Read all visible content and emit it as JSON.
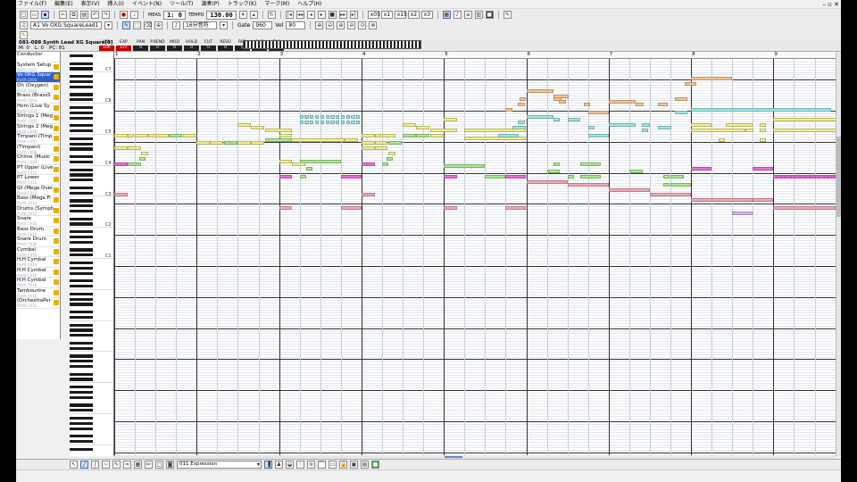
{
  "menu": [
    "ファイル(F)",
    "編集(E)",
    "表示(V)",
    "挿入(I)",
    "イベント(N)",
    "ツール(T)",
    "演奏(P)",
    "トラック(K)",
    "マーク(M)",
    "ヘルプ(H)"
  ],
  "toolbar": {
    "meas_label": "MEAS",
    "position": "1:  0",
    "tempo_label": "TEMPO",
    "tempo": "130.00",
    "tb_buttons": [
      "x05",
      "x1",
      "x15",
      "x2",
      "x3"
    ]
  },
  "toolbar2": {
    "track_select": "A1 Vo OXG SquareLead1",
    "quantize": "16分音符",
    "gate_label": "Gate",
    "gate": "960",
    "vel_label": "Vel",
    "vel": "80"
  },
  "trackinfo": {
    "name": "081-088 Synth Lead XG Square[0]",
    "meta": [
      {
        "k": "M",
        "v": "0"
      },
      {
        "k": "L",
        "v": "0"
      },
      {
        "k": "PC",
        "v": "81"
      }
    ],
    "params": [
      {
        "k": "VOL",
        "v": "100",
        "hl": true
      },
      {
        "k": "EXP",
        "v": "127",
        "hl": true
      },
      {
        "k": "PAN",
        "v": "0"
      },
      {
        "k": "P.BEND",
        "v": "0"
      },
      {
        "k": "MOD",
        "v": "0"
      },
      {
        "k": "HOLD",
        "v": "0"
      },
      {
        "k": "CUT",
        "v": "0"
      },
      {
        "k": "RESO",
        "v": "0"
      },
      {
        "k": "REV",
        "v": "0"
      },
      {
        "k": "CHO",
        "v": "0"
      },
      {
        "k": "DLY",
        "v": "0"
      }
    ]
  },
  "tracks": [
    {
      "name": "Conductor",
      "sub": "",
      "sel": false,
      "spk": false
    },
    {
      "name": "System Setup",
      "sub": "PartA Ch01",
      "sel": false,
      "spk": true
    },
    {
      "name": "Vo OXG Squar",
      "sub": "PartA Ch01",
      "sel": true,
      "spk": true
    },
    {
      "name": "Oh (Oxygen)",
      "sub": "PartA Ch02",
      "sel": false,
      "spk": true
    },
    {
      "name": "Brass (BrassS",
      "sub": "PartA Ch03",
      "sel": false,
      "spk": true
    },
    {
      "name": "Horn (Live Sy",
      "sub": "PartA Ch04",
      "sel": false,
      "spk": true
    },
    {
      "name": "Strings 1 (Meg",
      "sub": "PartA Ch05",
      "sel": false,
      "spk": true
    },
    {
      "name": "Strings 2 (Meg",
      "sub": "PartA Ch06",
      "sel": false,
      "spk": true
    },
    {
      "name": "Timpani (Timp",
      "sub": "PartA Ch07",
      "sel": false,
      "spk": true
    },
    {
      "name": "(Timpani)",
      "sub": "PartA Ch08",
      "sel": false,
      "spk": true
    },
    {
      "name": "Chime (Music",
      "sub": "PartA Ch09",
      "sel": false,
      "spk": true
    },
    {
      "name": "PT Upper (Live",
      "sub": "PartA Ch11",
      "sel": false,
      "spk": true
    },
    {
      "name": "PT Lower",
      "sub": "PartA Ch12",
      "sel": false,
      "spk": true
    },
    {
      "name": "Gt (Mega Over",
      "sub": "PartA Ch13",
      "sel": false,
      "spk": true
    },
    {
      "name": "Bass (Mega Fi",
      "sub": "PartA Ch14",
      "sel": false,
      "spk": true
    },
    {
      "name": "Drums (Symph",
      "sub": "PartA Ch15",
      "sel": false,
      "spk": true
    },
    {
      "name": "Snare",
      "sub": "PartA Ch16",
      "sel": false,
      "spk": true
    },
    {
      "name": "Bass Drum",
      "sub": "PartA Ch16",
      "sel": false,
      "spk": true
    },
    {
      "name": "Snare Drum",
      "sub": "PartA Ch16",
      "sel": false,
      "spk": true
    },
    {
      "name": "Cymbal",
      "sub": "PartA Ch16",
      "sel": false,
      "spk": true
    },
    {
      "name": "H.H Cymbal",
      "sub": "PartA Ch16",
      "sel": false,
      "spk": true
    },
    {
      "name": "H.H Cymbal",
      "sub": "PartA Ch16",
      "sel": false,
      "spk": true
    },
    {
      "name": "H.H Cymbal",
      "sub": "PartA Ch16",
      "sel": false,
      "spk": true
    },
    {
      "name": "Tambourine",
      "sub": "PartA Ch16",
      "sel": false,
      "spk": true
    },
    {
      "name": "(OrchestraPer",
      "sub": "PartA Ch16",
      "sel": false,
      "spk": true
    }
  ],
  "measures": [
    "1",
    "2",
    "3",
    "4",
    "5",
    "6",
    "7",
    "8",
    "9"
  ],
  "octave_labels": [
    "C7",
    "C6",
    "C5",
    "C4",
    "C3",
    "C2",
    "C1"
  ],
  "bottom": {
    "event_select": "011 Expression"
  },
  "colors": {
    "orange": "#f5c48f",
    "cyan": "#9ee8e4",
    "yellow": "#f4f08a",
    "green": "#a8ea8c",
    "magenta": "#f06ad8",
    "pink": "#f4a7b4",
    "lavender": "#d9b8f0"
  },
  "notes": [
    {
      "m": 8.0,
      "l": 0.5,
      "p": 96,
      "c": "orange"
    },
    {
      "m": 7.92,
      "l": 0.14,
      "p": 94,
      "c": "orange"
    },
    {
      "m": 6.0,
      "l": 0.33,
      "p": 91,
      "c": "orange"
    },
    {
      "m": 6.33,
      "l": 0.18,
      "p": 89,
      "c": "orange"
    },
    {
      "m": 5.92,
      "l": 0.08,
      "p": 88,
      "c": "orange"
    },
    {
      "m": 6.33,
      "l": 0.1,
      "p": 88,
      "c": "orange"
    },
    {
      "m": 6.4,
      "l": 0.08,
      "p": 87,
      "c": "orange"
    },
    {
      "m": 7.0,
      "l": 0.33,
      "p": 87,
      "c": "orange"
    },
    {
      "m": 5.9,
      "l": 0.08,
      "p": 86,
      "c": "orange"
    },
    {
      "m": 6.7,
      "l": 0.08,
      "p": 86,
      "c": "orange"
    },
    {
      "m": 7.33,
      "l": 0.1,
      "p": 86,
      "c": "orange"
    },
    {
      "m": 7.6,
      "l": 0.12,
      "p": 86,
      "c": "orange"
    },
    {
      "m": 7.8,
      "l": 0.16,
      "p": 88,
      "c": "orange"
    },
    {
      "m": 5.75,
      "l": 0.08,
      "p": 84,
      "c": "orange"
    },
    {
      "m": 6.75,
      "l": 0.25,
      "p": 83,
      "c": "orange"
    },
    {
      "m": 8.0,
      "l": 1.7,
      "p": 84,
      "c": "cyan"
    },
    {
      "m": 7.8,
      "l": 0.16,
      "p": 83,
      "c": "cyan"
    },
    {
      "m": 6.0,
      "l": 0.33,
      "p": 81,
      "c": "cyan"
    },
    {
      "m": 6.33,
      "l": 0.08,
      "p": 80,
      "c": "cyan"
    },
    {
      "m": 6.5,
      "l": 0.16,
      "p": 80,
      "c": "cyan"
    },
    {
      "m": 5.9,
      "l": 0.08,
      "p": 79,
      "c": "cyan"
    },
    {
      "m": 7.0,
      "l": 0.33,
      "p": 78,
      "c": "cyan"
    },
    {
      "m": 7.4,
      "l": 0.1,
      "p": 78,
      "c": "cyan"
    },
    {
      "m": 5.83,
      "l": 0.16,
      "p": 77,
      "c": "cyan"
    },
    {
      "m": 6.75,
      "l": 0.08,
      "p": 77,
      "c": "cyan"
    },
    {
      "m": 7.6,
      "l": 0.16,
      "p": 77,
      "c": "cyan"
    },
    {
      "m": 7.4,
      "l": 0.08,
      "p": 76,
      "c": "cyan"
    },
    {
      "m": 6.75,
      "l": 0.25,
      "p": 74,
      "c": "cyan"
    },
    {
      "m": 8.0,
      "l": 0.25,
      "p": 78,
      "c": "yellow"
    },
    {
      "m": 8.42,
      "l": 0.33,
      "p": 78,
      "c": "yellow"
    },
    {
      "m": 8.83,
      "l": 0.08,
      "p": 78,
      "c": "yellow"
    },
    {
      "m": 9.0,
      "l": 0.8,
      "p": 80,
      "c": "yellow"
    },
    {
      "m": 8.0,
      "l": 0.66,
      "p": 76,
      "c": "yellow"
    },
    {
      "m": 8.66,
      "l": 0.1,
      "p": 76,
      "c": "yellow"
    },
    {
      "m": 8.83,
      "l": 0.08,
      "p": 76,
      "c": "yellow"
    },
    {
      "m": 9.0,
      "l": 0.8,
      "p": 76,
      "c": "yellow"
    },
    {
      "m": 8.33,
      "l": 0.08,
      "p": 72,
      "c": "yellow"
    },
    {
      "m": 8.83,
      "l": 0.08,
      "p": 72,
      "c": "yellow"
    },
    {
      "m": 2.5,
      "l": 0.16,
      "p": 78,
      "c": "yellow"
    },
    {
      "m": 2.66,
      "l": 0.16,
      "p": 77,
      "c": "yellow"
    },
    {
      "m": 2.83,
      "l": 0.33,
      "p": 76,
      "c": "yellow"
    },
    {
      "m": 4.5,
      "l": 0.16,
      "p": 78,
      "c": "yellow"
    },
    {
      "m": 4.66,
      "l": 0.16,
      "p": 77,
      "c": "yellow"
    },
    {
      "m": 4.83,
      "l": 0.33,
      "p": 76,
      "c": "yellow"
    },
    {
      "m": 5.0,
      "l": 0.16,
      "p": 80,
      "c": "yellow"
    },
    {
      "m": 5.25,
      "l": 0.75,
      "p": 76,
      "c": "yellow"
    },
    {
      "m": 1.0,
      "l": 0.16,
      "p": 74,
      "c": "yellow"
    },
    {
      "m": 1.16,
      "l": 0.08,
      "p": 74,
      "c": "yellow"
    },
    {
      "m": 1.25,
      "l": 0.16,
      "p": 74,
      "c": "yellow"
    },
    {
      "m": 1.41,
      "l": 0.08,
      "p": 74,
      "c": "yellow"
    },
    {
      "m": 1.5,
      "l": 0.16,
      "p": 74,
      "c": "yellow"
    },
    {
      "m": 1.66,
      "l": 0.16,
      "p": 74,
      "c": "green"
    },
    {
      "m": 1.83,
      "l": 0.16,
      "p": 74,
      "c": "yellow"
    },
    {
      "m": 3.0,
      "l": 0.16,
      "p": 74,
      "c": "yellow"
    },
    {
      "m": 3.0,
      "l": 0.8,
      "p": 72,
      "c": "yellow"
    },
    {
      "m": 3.8,
      "l": 0.16,
      "p": 72,
      "c": "yellow"
    },
    {
      "m": 4.0,
      "l": 0.16,
      "p": 74,
      "c": "yellow"
    },
    {
      "m": 4.16,
      "l": 0.08,
      "p": 74,
      "c": "yellow"
    },
    {
      "m": 4.25,
      "l": 0.16,
      "p": 74,
      "c": "yellow"
    },
    {
      "m": 4.5,
      "l": 0.16,
      "p": 74,
      "c": "green"
    },
    {
      "m": 4.66,
      "l": 0.16,
      "p": 74,
      "c": "green"
    },
    {
      "m": 4.83,
      "l": 0.16,
      "p": 74,
      "c": "yellow"
    },
    {
      "m": 5.25,
      "l": 0.75,
      "p": 73,
      "c": "yellow"
    },
    {
      "m": 2.0,
      "l": 0.16,
      "p": 71,
      "c": "yellow"
    },
    {
      "m": 2.16,
      "l": 0.16,
      "p": 71,
      "c": "yellow"
    },
    {
      "m": 2.33,
      "l": 0.16,
      "p": 71,
      "c": "green"
    },
    {
      "m": 2.5,
      "l": 0.16,
      "p": 71,
      "c": "yellow"
    },
    {
      "m": 2.66,
      "l": 0.16,
      "p": 71,
      "c": "yellow"
    },
    {
      "m": 2.83,
      "l": 0.33,
      "p": 72,
      "c": "green"
    },
    {
      "m": 4.0,
      "l": 0.16,
      "p": 71,
      "c": "yellow"
    },
    {
      "m": 4.16,
      "l": 0.16,
      "p": 71,
      "c": "yellow"
    },
    {
      "m": 4.33,
      "l": 0.16,
      "p": 71,
      "c": "green"
    },
    {
      "m": 5.66,
      "l": 0.25,
      "p": 74,
      "c": "cyan"
    },
    {
      "m": 6.75,
      "l": 0.25,
      "p": 74,
      "c": "cyan"
    },
    {
      "m": 1.0,
      "l": 0.16,
      "p": 69,
      "c": "yellow"
    },
    {
      "m": 1.16,
      "l": 0.16,
      "p": 69,
      "c": "yellow"
    },
    {
      "m": 1.33,
      "l": 0.08,
      "p": 67,
      "c": "yellow"
    },
    {
      "m": 1.3,
      "l": 0.08,
      "p": 65,
      "c": "green"
    },
    {
      "m": 1.0,
      "l": 0.16,
      "p": 63,
      "c": "magenta"
    },
    {
      "m": 1.16,
      "l": 0.16,
      "p": 63,
      "c": "green"
    },
    {
      "m": 4.0,
      "l": 0.16,
      "p": 69,
      "c": "yellow"
    },
    {
      "m": 4.16,
      "l": 0.16,
      "p": 69,
      "c": "yellow"
    },
    {
      "m": 4.33,
      "l": 0.08,
      "p": 67,
      "c": "yellow"
    },
    {
      "m": 4.3,
      "l": 0.08,
      "p": 65,
      "c": "green"
    },
    {
      "m": 3.0,
      "l": 0.16,
      "p": 64,
      "c": "yellow"
    },
    {
      "m": 3.25,
      "l": 0.5,
      "p": 64,
      "c": "green"
    },
    {
      "m": 3.16,
      "l": 0.16,
      "p": 63,
      "c": "yellow"
    },
    {
      "m": 4.0,
      "l": 0.16,
      "p": 63,
      "c": "magenta"
    },
    {
      "m": 4.25,
      "l": 0.08,
      "p": 63,
      "c": "green"
    },
    {
      "m": 5.0,
      "l": 0.5,
      "p": 62,
      "c": "green"
    },
    {
      "m": 6.66,
      "l": 0.25,
      "p": 63,
      "c": "green"
    },
    {
      "m": 6.33,
      "l": 0.08,
      "p": 63,
      "c": "green"
    },
    {
      "m": 3.33,
      "l": 0.08,
      "p": 61,
      "c": "green"
    },
    {
      "m": 6.25,
      "l": 0.16,
      "p": 60,
      "c": "green"
    },
    {
      "m": 7.25,
      "l": 0.16,
      "p": 60,
      "c": "green"
    },
    {
      "m": 8.0,
      "l": 0.25,
      "p": 61,
      "c": "magenta"
    },
    {
      "m": 8.75,
      "l": 0.25,
      "p": 61,
      "c": "magenta"
    },
    {
      "m": 3.0,
      "l": 0.16,
      "p": 58,
      "c": "magenta"
    },
    {
      "m": 3.25,
      "l": 0.08,
      "p": 58,
      "c": "green"
    },
    {
      "m": 3.75,
      "l": 0.25,
      "p": 58,
      "c": "magenta"
    },
    {
      "m": 5.0,
      "l": 0.16,
      "p": 58,
      "c": "magenta"
    },
    {
      "m": 5.5,
      "l": 0.25,
      "p": 58,
      "c": "green"
    },
    {
      "m": 5.75,
      "l": 0.25,
      "p": 58,
      "c": "magenta"
    },
    {
      "m": 6.5,
      "l": 0.08,
      "p": 58,
      "c": "green"
    },
    {
      "m": 6.66,
      "l": 0.25,
      "p": 58,
      "c": "green"
    },
    {
      "m": 7.66,
      "l": 0.08,
      "p": 58,
      "c": "green"
    },
    {
      "m": 7.75,
      "l": 0.16,
      "p": 58,
      "c": "green"
    },
    {
      "m": 9.0,
      "l": 0.75,
      "p": 58,
      "c": "magenta"
    },
    {
      "m": 6.0,
      "l": 0.5,
      "p": 56,
      "c": "pink"
    },
    {
      "m": 6.5,
      "l": 0.5,
      "p": 55,
      "c": "pink"
    },
    {
      "m": 7.66,
      "l": 0.08,
      "p": 55,
      "c": "green"
    },
    {
      "m": 7.75,
      "l": 0.25,
      "p": 55,
      "c": "green"
    },
    {
      "m": 7.0,
      "l": 0.5,
      "p": 53,
      "c": "pink"
    },
    {
      "m": 7.5,
      "l": 0.5,
      "p": 51,
      "c": "pink"
    },
    {
      "m": 1.0,
      "l": 0.16,
      "p": 51,
      "c": "pink"
    },
    {
      "m": 4.0,
      "l": 0.16,
      "p": 51,
      "c": "pink"
    },
    {
      "m": 8.0,
      "l": 0.75,
      "p": 49,
      "c": "pink"
    },
    {
      "m": 8.75,
      "l": 0.25,
      "p": 49,
      "c": "pink"
    },
    {
      "m": 3.0,
      "l": 0.16,
      "p": 46,
      "c": "pink"
    },
    {
      "m": 3.75,
      "l": 0.25,
      "p": 46,
      "c": "pink"
    },
    {
      "m": 5.0,
      "l": 0.16,
      "p": 46,
      "c": "pink"
    },
    {
      "m": 5.75,
      "l": 0.25,
      "p": 46,
      "c": "pink"
    },
    {
      "m": 9.0,
      "l": 0.75,
      "p": 46,
      "c": "pink"
    },
    {
      "m": 8.5,
      "l": 0.25,
      "p": 44,
      "c": "lavender"
    }
  ],
  "repeat_notes": [
    {
      "m": 3.25,
      "l": 0.75,
      "p": 81,
      "c": "cyan",
      "n": 12
    },
    {
      "m": 3.25,
      "l": 0.75,
      "p": 79,
      "c": "cyan",
      "n": 12
    },
    {
      "m": 9.0,
      "l": 0.75,
      "p": 58,
      "c": "magenta",
      "n": 14
    }
  ]
}
